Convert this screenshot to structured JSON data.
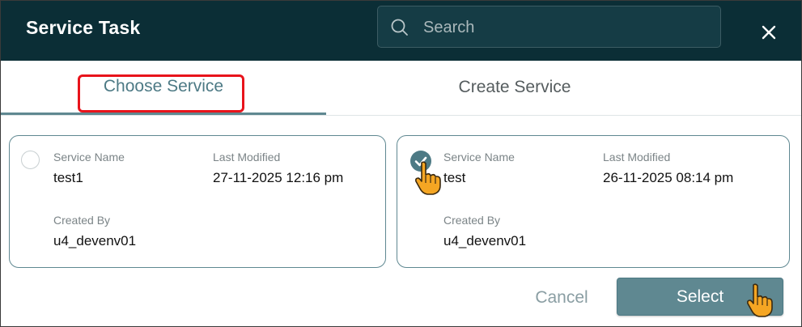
{
  "header": {
    "title": "Service Task",
    "search_placeholder": "Search"
  },
  "tabs": [
    {
      "label": "Choose Service",
      "active": true
    },
    {
      "label": "Create Service",
      "active": false
    }
  ],
  "cards": [
    {
      "selected": false,
      "service_name_label": "Service Name",
      "service_name": "test1",
      "last_modified_label": "Last Modified",
      "last_modified": "27-11-2025 12:16 pm",
      "created_by_label": "Created By",
      "created_by": "u4_devenv01"
    },
    {
      "selected": true,
      "service_name_label": "Service Name",
      "service_name": "test",
      "last_modified_label": "Last Modified",
      "last_modified": "26-11-2025 08:14 pm",
      "created_by_label": "Created By",
      "created_by": "u4_devenv01"
    }
  ],
  "footer": {
    "cancel_label": "Cancel",
    "select_label": "Select"
  },
  "colors": {
    "header_bg": "#0b2e36",
    "accent": "#5f8891",
    "highlight": "#e8131b",
    "cursor": "#f5a623"
  },
  "icons": {
    "search": "search-icon",
    "close": "close-icon",
    "check": "check-icon",
    "cursor": "hand-pointer-icon"
  }
}
